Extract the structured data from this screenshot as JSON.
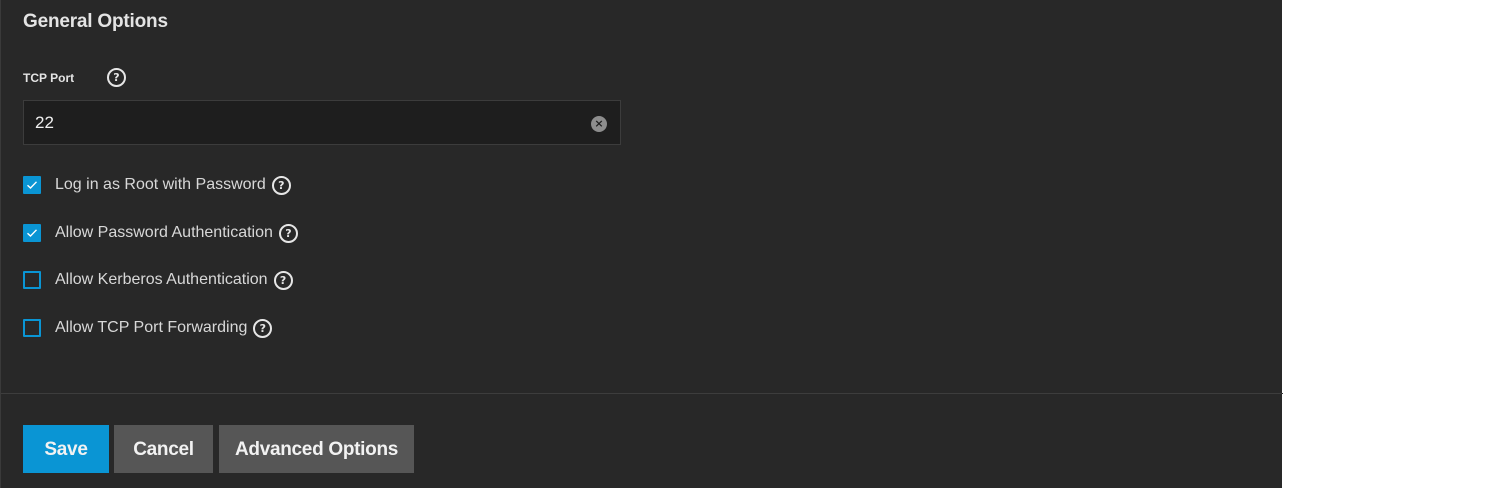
{
  "section": {
    "title": "General Options"
  },
  "tcp_port": {
    "label": "TCP Port",
    "value": "22",
    "help_icon": "help-circle-icon",
    "clear_icon": "clear-circle-icon"
  },
  "options": [
    {
      "label": "Log in as Root with Password",
      "checked": true
    },
    {
      "label": "Allow Password Authentication",
      "checked": true
    },
    {
      "label": "Allow Kerberos Authentication",
      "checked": false
    },
    {
      "label": "Allow TCP Port Forwarding",
      "checked": false
    }
  ],
  "actions": {
    "save_label": "Save",
    "cancel_label": "Cancel",
    "advanced_label": "Advanced Options"
  },
  "colors": {
    "panel_bg": "#282828",
    "accent": "#0a95d4",
    "secondary_button": "#565656",
    "input_bg": "#1e1e1e"
  }
}
